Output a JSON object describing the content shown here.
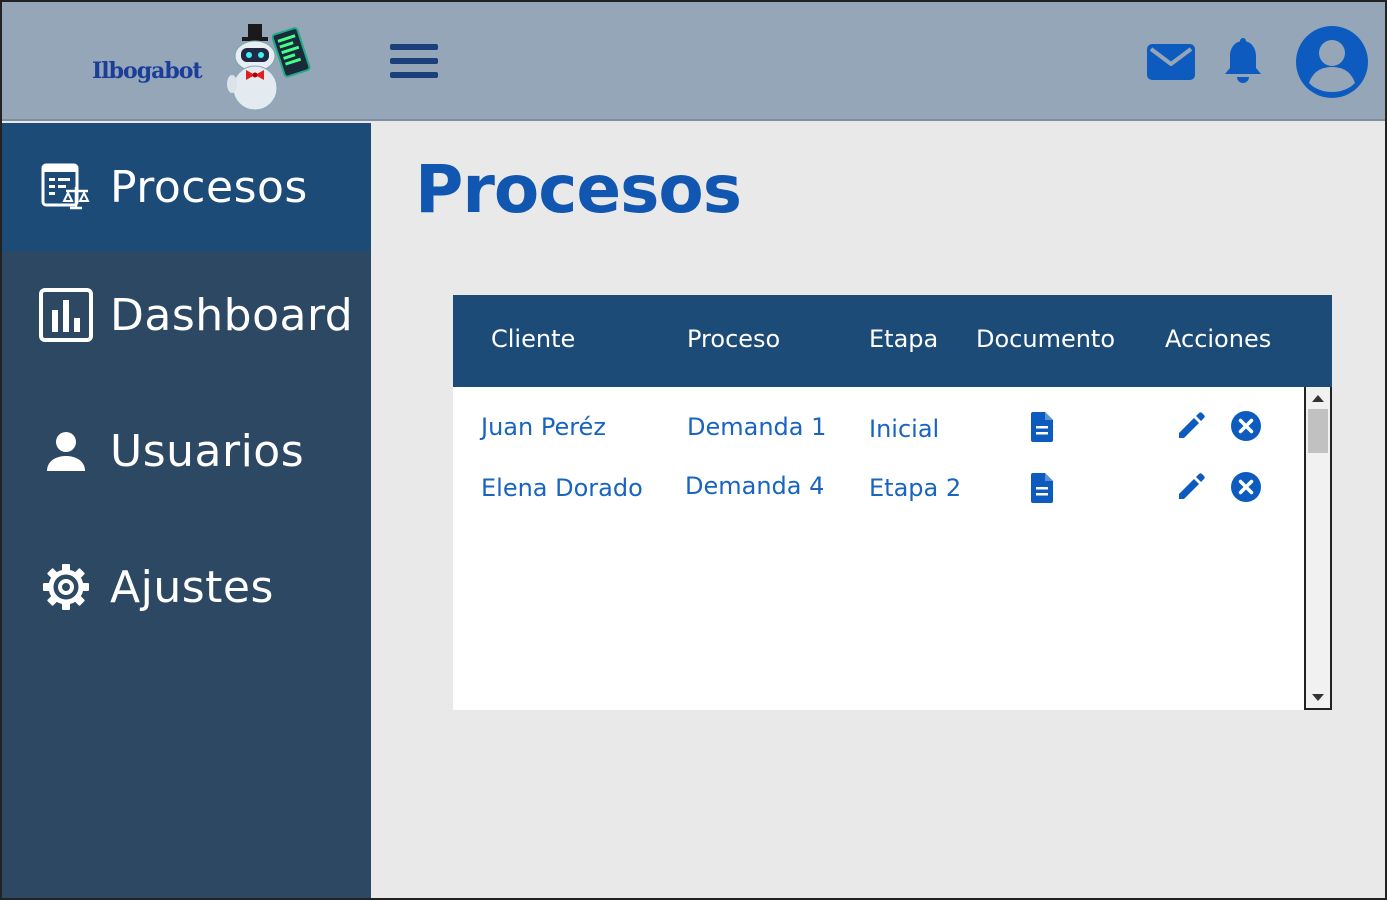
{
  "app": {
    "logo_text": "Ilbogabot",
    "colors": {
      "header_bg": "#94a6b7",
      "sidebar_bg": "#2d4862",
      "sidebar_active_bg": "#1c4b78",
      "accent": "#1157b2",
      "link": "#1864c0"
    }
  },
  "header": {
    "icons": [
      "menu-icon",
      "mail-icon",
      "bell-icon",
      "account-icon"
    ]
  },
  "sidebar": {
    "items": [
      {
        "label": "Procesos",
        "icon": "law-document-icon",
        "active": true
      },
      {
        "label": "Dashboard",
        "icon": "chart-icon",
        "active": false
      },
      {
        "label": "Usuarios",
        "icon": "user-icon",
        "active": false
      },
      {
        "label": "Ajustes",
        "icon": "gear-icon",
        "active": false
      }
    ]
  },
  "main": {
    "title": "Procesos",
    "table": {
      "columns": [
        "Cliente",
        "Proceso",
        "Etapa",
        "Documento",
        "Acciones"
      ],
      "rows": [
        {
          "cliente": "Juan Peréz",
          "proceso": "Demanda 1",
          "etapa": "Inicial"
        },
        {
          "cliente": "Elena Dorado",
          "proceso": "Demanda 4",
          "etapa": "Etapa 2"
        }
      ]
    }
  }
}
